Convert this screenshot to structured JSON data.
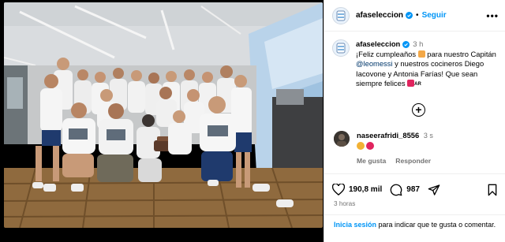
{
  "post": {
    "username": "afaseleccion",
    "follow_label": "Seguir",
    "more_label": "•••",
    "separator": "•"
  },
  "caption": {
    "username": "afaseleccion",
    "time": "3 h",
    "text_1": "¡Feliz cumpleaños ",
    "text_2": " para nuestro Capitán ",
    "mention": "@leomessi",
    "text_3": " y nuestros cocineros Diego Iacovone y Antonia Farías! Que sean siempre felices ",
    "flag_label": "AR"
  },
  "comment": {
    "username": "naseerafridi_8556",
    "time": "3 s",
    "like_label": "Me gusta",
    "reply_label": "Responder",
    "emoji_colors": [
      "#f2b134",
      "#e0245e"
    ]
  },
  "actions": {
    "likes": "190,8 mil",
    "comments": "987",
    "time_ago": "3 horas"
  },
  "login": {
    "link": "Inicia sesión",
    "rest": " para indicar que te gusta o comentar."
  },
  "colors": {
    "accent": "#0095f6",
    "muted": "#737373",
    "mention": "#00376b"
  },
  "icons": [
    "verified-badge-icon",
    "more-options-icon",
    "add-comment-icon",
    "heart-icon",
    "comment-icon",
    "share-icon",
    "bookmark-icon"
  ]
}
